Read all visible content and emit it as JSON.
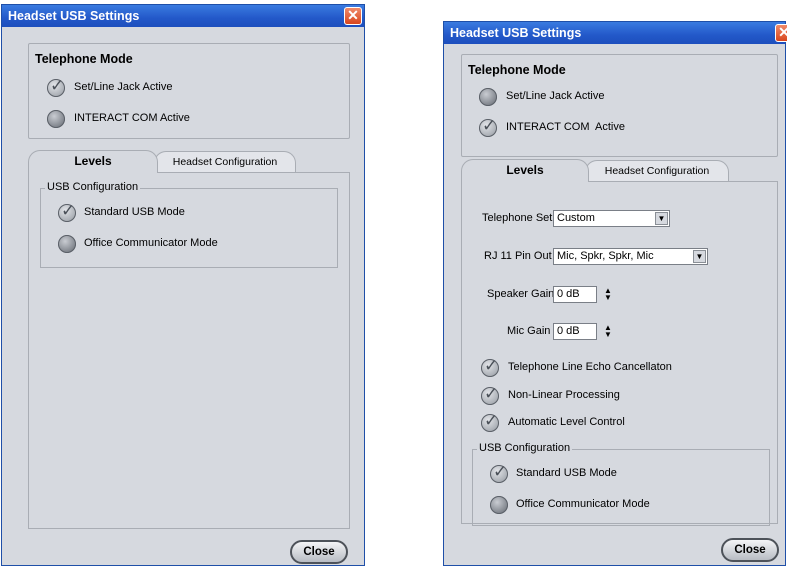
{
  "left_window": {
    "title": "Headset USB Settings",
    "close_glyph": "✕",
    "telephone_mode": {
      "heading": "Telephone Mode",
      "options": [
        {
          "label": "Set/Line Jack Active",
          "checked": true
        },
        {
          "label": "INTERACT COM Active",
          "checked": false
        }
      ]
    },
    "tabs": [
      {
        "label": "Levels",
        "active": true
      },
      {
        "label": "Headset Configuration",
        "active": false
      }
    ],
    "usb_configuration": {
      "legend": "USB Configuration",
      "options": [
        {
          "label": "Standard USB Mode",
          "checked": true
        },
        {
          "label": "Office Communicator Mode",
          "checked": false
        }
      ]
    },
    "close_label": "Close"
  },
  "right_window": {
    "title": "Headset USB Settings",
    "close_glyph": "✕",
    "telephone_mode": {
      "heading": "Telephone Mode",
      "options": [
        {
          "label": "Set/Line Jack Active",
          "checked": false
        },
        {
          "label": "INTERACT COM  Active",
          "checked": true
        }
      ]
    },
    "tabs": [
      {
        "label": "Levels",
        "active": true
      },
      {
        "label": "Headset Configuration",
        "active": false
      }
    ],
    "telephone_set": {
      "label": "Telephone Set",
      "value": "Custom"
    },
    "rj11_pin_out": {
      "label": "RJ 11 Pin Out",
      "value": "Mic, Spkr, Spkr, Mic"
    },
    "speaker_gain": {
      "label": "Speaker Gain",
      "value": "0 dB"
    },
    "mic_gain": {
      "label": "Mic Gain",
      "value": "0 dB"
    },
    "checks": [
      {
        "label": "Telephone Line Echo Cancellaton",
        "checked": true
      },
      {
        "label": "Non-Linear Processing",
        "checked": true
      },
      {
        "label": "Automatic Level Control",
        "checked": true
      }
    ],
    "usb_configuration": {
      "legend": "USB Configuration",
      "options": [
        {
          "label": "Standard USB Mode",
          "checked": true
        },
        {
          "label": "Office Communicator Mode",
          "checked": false
        }
      ]
    },
    "close_label": "Close"
  },
  "colors": {
    "titlebar": "#2358c9",
    "window_bg": "#d6d9df",
    "close_box": "#d9461d"
  }
}
